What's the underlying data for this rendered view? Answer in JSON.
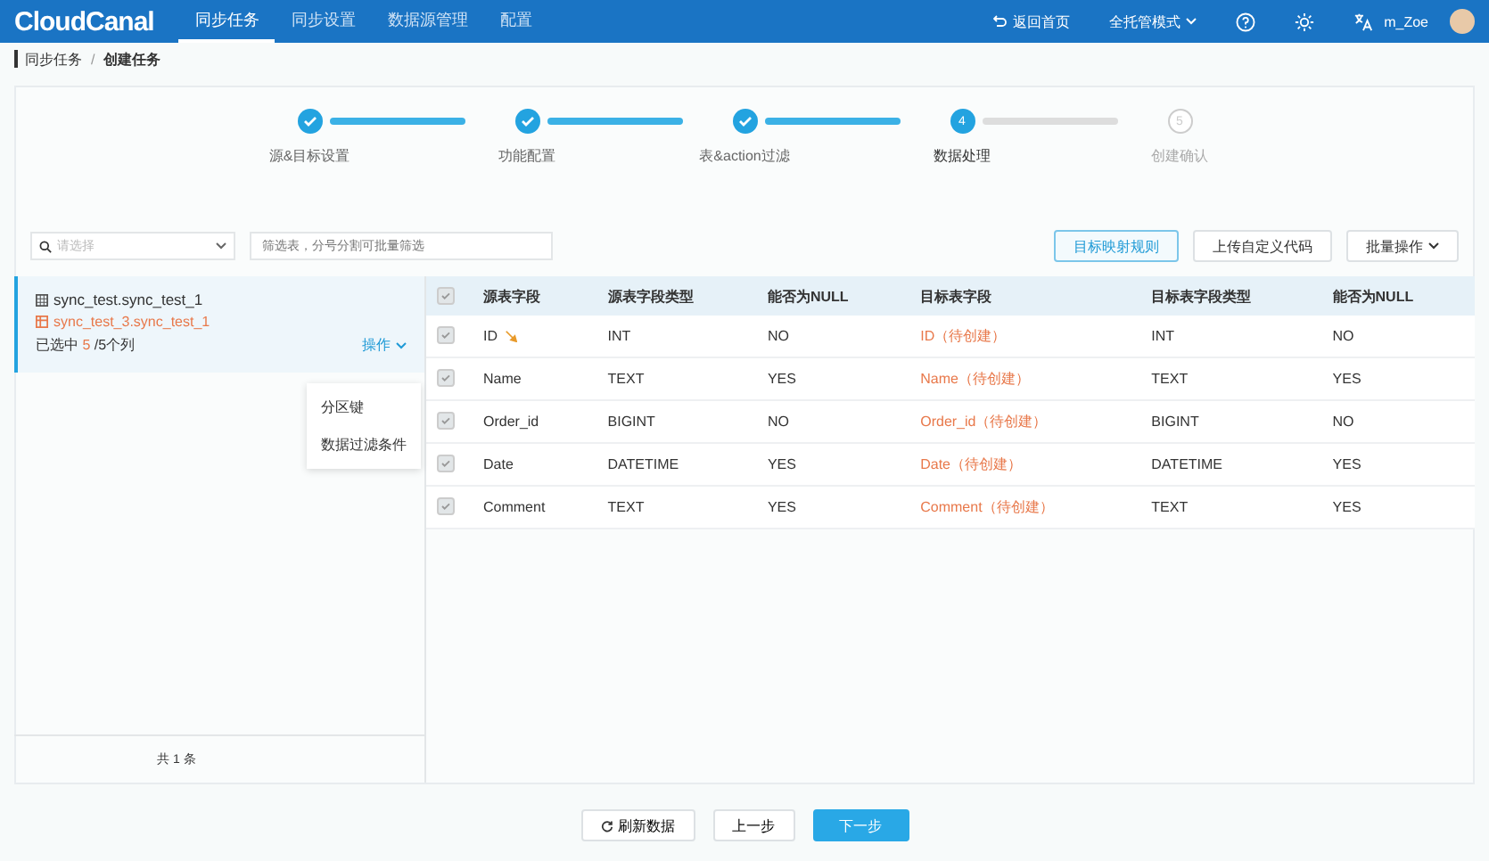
{
  "header": {
    "logo": "CloudCanal",
    "nav": [
      {
        "label": "同步任务",
        "selected": true
      },
      {
        "label": "同步设置",
        "selected": false
      },
      {
        "label": "数据源管理",
        "selected": false
      },
      {
        "label": "配置",
        "selected": false
      }
    ],
    "back_home": "返回首页",
    "mode": "全托管模式",
    "user": "m_Zoe"
  },
  "breadcrumb": {
    "items": [
      "同步任务",
      "创建任务"
    ],
    "separator": "/"
  },
  "steps": [
    {
      "label": "源&目标设置",
      "completed": true,
      "selected": false
    },
    {
      "label": "功能配置",
      "completed": true,
      "selected": false
    },
    {
      "label": "表&action过滤",
      "completed": true,
      "selected": false
    },
    {
      "label": "数据处理",
      "completed": false,
      "selected": true,
      "number": "4"
    },
    {
      "label": "创建确认",
      "completed": false,
      "selected": false,
      "number": "5"
    }
  ],
  "toolbar": {
    "select_placeholder": "请选择",
    "filter_placeholder": "筛选表，分号分割可批量筛选",
    "buttons": [
      {
        "label": "目标映射规则",
        "primary": true
      },
      {
        "label": "上传自定义代码",
        "primary": false
      },
      {
        "label": "批量操作",
        "primary": false
      }
    ]
  },
  "table_list": {
    "items": [
      {
        "source": "sync_test.sync_test_1",
        "target": "sync_test_3.sync_test_1",
        "selected_prefix": "已选中",
        "selected_count": "5",
        "selected_suffix": "/5个列",
        "action": "操作",
        "selected": true
      }
    ],
    "menu": [
      "分区键",
      "数据过滤条件"
    ],
    "total": "共 1 条"
  },
  "table": {
    "all_checked": true,
    "columns": [
      "源表字段",
      "源表字段类型",
      "能否为NULL",
      "目标表字段",
      "目标表字段类型",
      "能否为NULL"
    ],
    "rows": [
      {
        "checked": true,
        "key": true,
        "cells": [
          "ID",
          "INT",
          "NO",
          "ID（待创建）",
          "INT",
          "NO"
        ]
      },
      {
        "checked": true,
        "key": false,
        "cells": [
          "Name",
          "TEXT",
          "YES",
          "Name（待创建）",
          "TEXT",
          "YES"
        ]
      },
      {
        "checked": true,
        "key": false,
        "cells": [
          "Order_id",
          "BIGINT",
          "NO",
          "Order_id（待创建）",
          "BIGINT",
          "NO"
        ]
      },
      {
        "checked": true,
        "key": false,
        "cells": [
          "Date",
          "DATETIME",
          "YES",
          "Date（待创建）",
          "DATETIME",
          "YES"
        ]
      },
      {
        "checked": true,
        "key": false,
        "cells": [
          "Comment",
          "TEXT",
          "YES",
          "Comment（待创建）",
          "TEXT",
          "YES"
        ]
      }
    ]
  },
  "footer": [
    {
      "label": "刷新数据",
      "kind": "refresh"
    },
    {
      "label": "上一步",
      "kind": "default"
    },
    {
      "label": "下一步",
      "kind": "primary"
    }
  ]
}
